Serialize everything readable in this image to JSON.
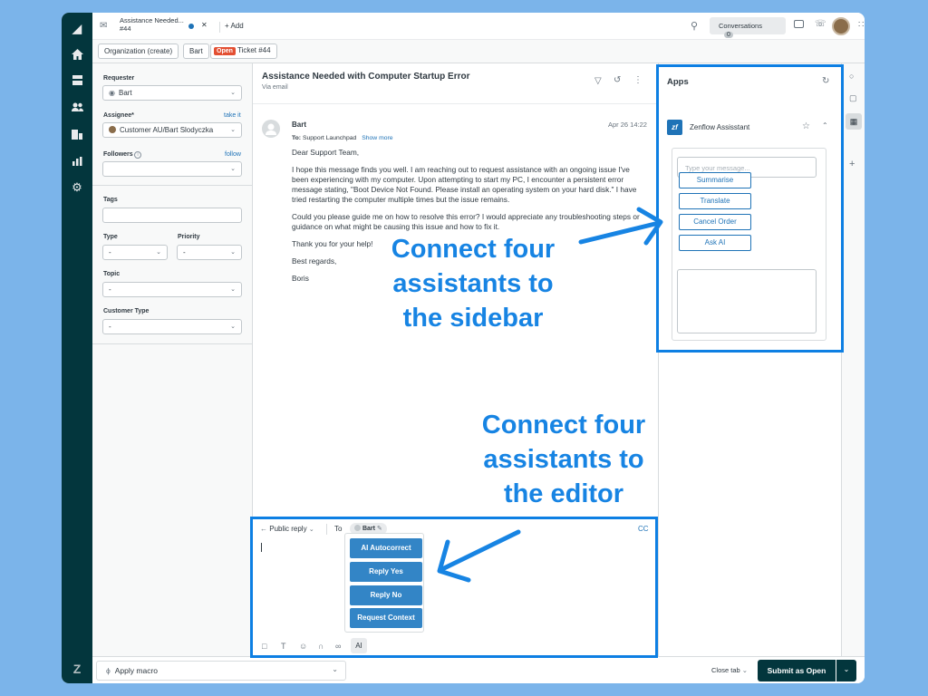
{
  "topbar": {
    "tab_title": "Assistance Needed...",
    "tab_subtitle": "#44",
    "add_label": "+ Add",
    "conversations_label": "Conversations",
    "conversations_count": "0"
  },
  "breadcrumbs": {
    "org": "Organization (create)",
    "user": "Bart",
    "status": "Open",
    "ticket": "Ticket #44"
  },
  "properties": {
    "requester_label": "Requester",
    "requester_value": "Bart",
    "assignee_label": "Assignee*",
    "take_it": "take it",
    "assignee_value": "Customer AU/Bart Slodyczka",
    "followers_label": "Followers",
    "follow": "follow",
    "tags_label": "Tags",
    "type_label": "Type",
    "type_value": "-",
    "priority_label": "Priority",
    "priority_value": "-",
    "topic_label": "Topic",
    "topic_value": "-",
    "customer_type_label": "Customer Type",
    "customer_type_value": "-"
  },
  "ticket": {
    "subject": "Assistance Needed with Computer Startup Error",
    "channel": "Via email",
    "sender": "Bart",
    "date": "Apr 26 14:22",
    "to_label": "To:",
    "to_value": "Support Launchpad",
    "show_more": "Show more",
    "body": [
      "Dear Support Team,",
      "I hope this message finds you well. I am reaching out to request assistance with an ongoing issue I've been experiencing with my computer. Upon attempting to start my PC, I encounter a persistent error message stating, \"Boot Device Not Found. Please install an operating system on your hard disk.\" I have tried restarting the computer multiple times but the issue remains.",
      "Could you please guide me on how to resolve this error? I would appreciate any troubleshooting steps or guidance on what might be causing this issue and how to fix it.",
      "Thank you for your help!",
      "Best regards,",
      "Boris"
    ]
  },
  "editor": {
    "reply_type": "Public reply",
    "to_label": "To",
    "recipient": "Bart",
    "cc": "CC",
    "ai_buttons": [
      "AI Autocorrect",
      "Reply Yes",
      "Reply No",
      "Request Context"
    ],
    "ai_tool": "AI"
  },
  "apps": {
    "title": "Apps",
    "app_name": "Zenflow Assisstant",
    "logo_text": "zf",
    "input_placeholder": "Type your message...",
    "buttons": [
      "Summarise",
      "Translate",
      "Cancel Order",
      "Ask AI"
    ]
  },
  "bottombar": {
    "apply_macro": "Apply macro",
    "close_tab": "Close tab",
    "submit": "Submit as Open"
  },
  "annotations": {
    "sidebar_lines": [
      "Connect four",
      "assistants to",
      "the sidebar"
    ],
    "editor_lines": [
      "Connect four",
      "assistants to",
      "the editor"
    ]
  },
  "colors": {
    "accent": "#1f73b7",
    "highlight": "#0d7fe3",
    "open_badge": "#e34f32",
    "nav": "#03363d",
    "ai_button": "#3385c6"
  }
}
